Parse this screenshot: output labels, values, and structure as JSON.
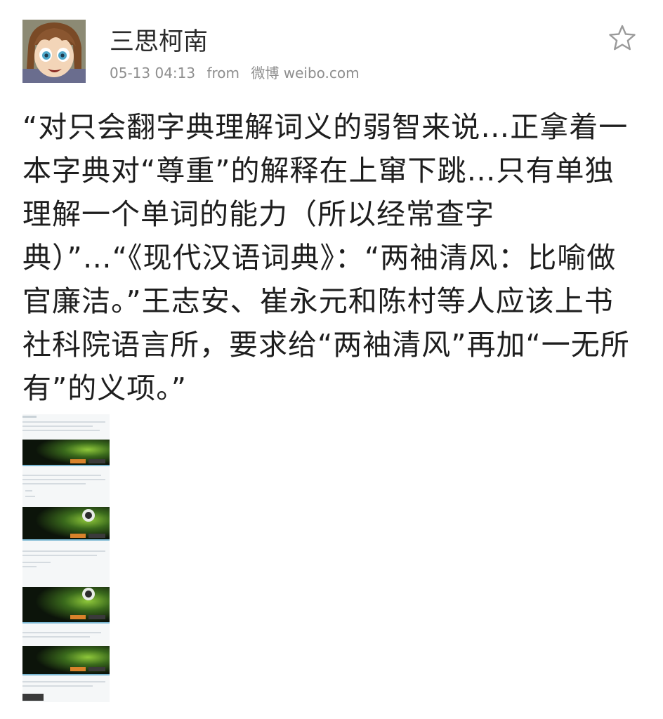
{
  "post": {
    "username": "三思柯南",
    "timestamp": "05-13 04:13",
    "from_label": "from",
    "source": "微博 weibo.com",
    "text": "“对只会翻字典理解词义的弱智来说…正拿着一本字典对“尊重”的解释在上窜下跳…只有单独理解一个单词的能力（所以经常查字典）”…“《现代汉语词典》：“两袖清风：比喻做官廉洁。”王志安、崔永元和陈村等人应该上书社科院语言所，要求给“两袖清风”再加“一无所有”的义项。”"
  },
  "icons": {
    "favorite": "star-outline-icon"
  },
  "colors": {
    "meta_text": "#8e8e8e",
    "body_text": "#1e1e1e",
    "star": "#9a9a9a"
  }
}
